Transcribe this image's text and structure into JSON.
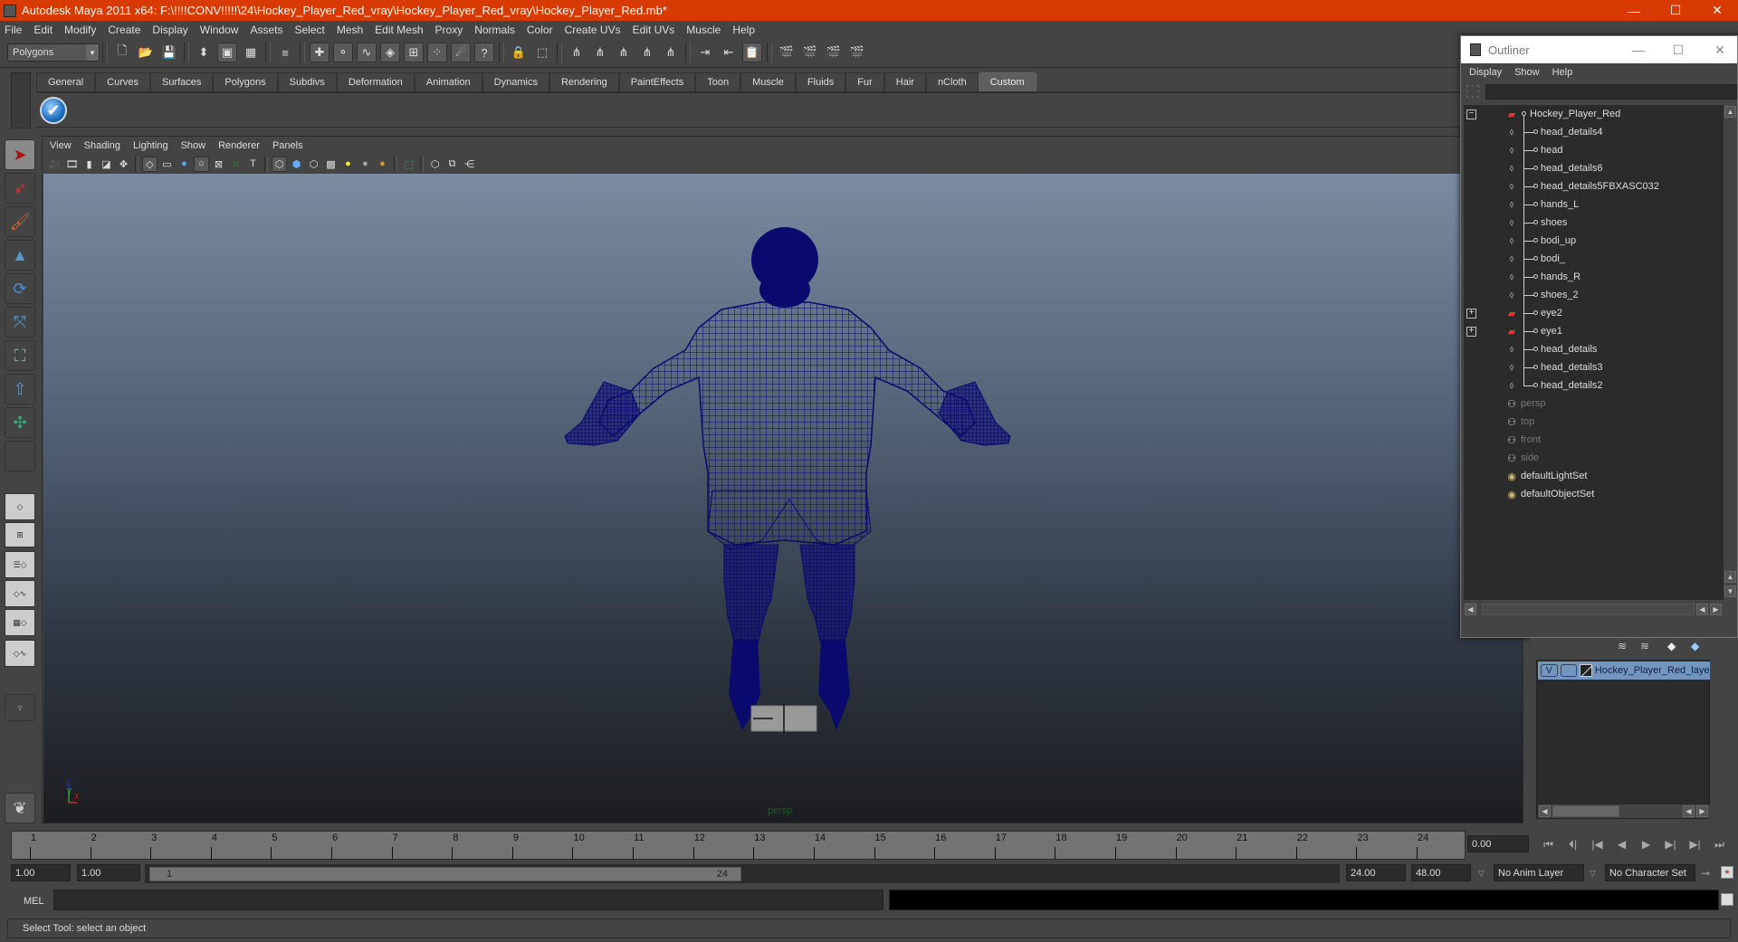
{
  "window": {
    "title": "Autodesk Maya 2011 x64: F:\\!!!!CONV!!!!!\\24\\Hockey_Player_Red_vray\\Hockey_Player_Red_vray\\Hockey_Player_Red.mb*",
    "minimize": "—",
    "maximize": "☐",
    "close": "✕"
  },
  "menubar": [
    "File",
    "Edit",
    "Modify",
    "Create",
    "Display",
    "Window",
    "Assets",
    "Select",
    "Mesh",
    "Edit Mesh",
    "Proxy",
    "Normals",
    "Color",
    "Create UVs",
    "Edit UVs",
    "Muscle",
    "Help"
  ],
  "statusline": {
    "mode": "Polygons",
    "icons": [
      {
        "name": "new-scene-icon",
        "glyph": "🗋"
      },
      {
        "name": "open-scene-icon",
        "glyph": "📂"
      },
      {
        "name": "save-scene-icon",
        "glyph": "💾"
      },
      {
        "name": "select-by-hierarchy-icon",
        "glyph": "⬍"
      },
      {
        "name": "select-by-object-type-icon",
        "glyph": "▣",
        "on": true
      },
      {
        "name": "select-by-component-type-icon",
        "glyph": "▦"
      },
      {
        "name": "mask-menu-icon",
        "glyph": "≡"
      },
      {
        "name": "select-handles-icon",
        "glyph": "✚",
        "on": true
      },
      {
        "name": "select-joints-icon",
        "glyph": "⚬",
        "on": true
      },
      {
        "name": "select-curves-icon",
        "glyph": "∿",
        "on": true
      },
      {
        "name": "select-surfaces-icon",
        "glyph": "◈",
        "on": true
      },
      {
        "name": "select-deformations-icon",
        "glyph": "⊞",
        "on": true
      },
      {
        "name": "select-dynamics-icon",
        "glyph": "⁘",
        "on": true
      },
      {
        "name": "select-rendering-icon",
        "glyph": "☄",
        "on": true
      },
      {
        "name": "select-misc-icon",
        "glyph": "?",
        "on": true
      },
      {
        "name": "lock-selection-icon",
        "glyph": "🔒"
      },
      {
        "name": "highlight-selection-icon",
        "glyph": "⬚"
      },
      {
        "name": "snap-to-grids-icon",
        "glyph": "⋔"
      },
      {
        "name": "snap-to-curves-icon",
        "glyph": "⋔"
      },
      {
        "name": "snap-to-points-icon",
        "glyph": "⋔"
      },
      {
        "name": "snap-to-view-planes-icon",
        "glyph": "⋔"
      },
      {
        "name": "make-live-icon",
        "glyph": "⋔"
      },
      {
        "name": "input-ops-icon",
        "glyph": "⇥"
      },
      {
        "name": "output-ops-icon",
        "glyph": "⇤"
      },
      {
        "name": "construction-history-icon",
        "glyph": "📋",
        "on": true
      },
      {
        "name": "render-view-icon",
        "glyph": "🎬"
      },
      {
        "name": "render-current-frame-icon",
        "glyph": "🎬"
      },
      {
        "name": "ipr-render-icon",
        "glyph": "🎬"
      },
      {
        "name": "render-settings-icon",
        "glyph": "🎬"
      }
    ]
  },
  "shelf": {
    "tabs": [
      "General",
      "Curves",
      "Surfaces",
      "Polygons",
      "Subdivs",
      "Deformation",
      "Animation",
      "Dynamics",
      "Rendering",
      "PaintEffects",
      "Toon",
      "Muscle",
      "Fluids",
      "Fur",
      "Hair",
      "nCloth",
      "Custom"
    ],
    "active_tab": "Custom",
    "items": [
      {
        "name": "custom-check-icon",
        "glyph": "✔"
      }
    ]
  },
  "toolbox": {
    "tools": [
      {
        "name": "select-tool-icon",
        "glyph": "➤",
        "selected": true
      },
      {
        "name": "lasso-tool-icon",
        "glyph": "➶"
      },
      {
        "name": "paint-select-tool-icon",
        "glyph": "🖌"
      },
      {
        "name": "move-tool-icon",
        "glyph": "▲"
      },
      {
        "name": "rotate-tool-icon",
        "glyph": "⟳"
      },
      {
        "name": "scale-tool-icon",
        "glyph": "⤧"
      },
      {
        "name": "universal-manipulator-icon",
        "glyph": "⛶"
      },
      {
        "name": "soft-modification-icon",
        "glyph": "⇧"
      },
      {
        "name": "show-manipulator-icon",
        "glyph": "✣"
      },
      {
        "name": "last-tool-slot-icon",
        "glyph": ""
      }
    ],
    "layouts": [
      {
        "name": "single-perspective-layout-icon",
        "glyph": "◇"
      },
      {
        "name": "four-view-layout-icon",
        "glyph": "⊞"
      },
      {
        "name": "outliner-perspective-layout-icon",
        "glyph": "☰◇"
      },
      {
        "name": "perspective-graph-layout-icon",
        "glyph": "◇∿"
      },
      {
        "name": "hypershade-perspective-layout-icon",
        "glyph": "▦◇"
      },
      {
        "name": "perspective-hypergraph-graph-layout-icon",
        "glyph": "◇∿"
      }
    ],
    "more_layouts": "▿"
  },
  "viewport": {
    "menu": [
      "View",
      "Shading",
      "Lighting",
      "Show",
      "Renderer",
      "Panels"
    ],
    "tools": [
      {
        "name": "select-camera-icon",
        "glyph": "🎥"
      },
      {
        "name": "camera-attributes-icon",
        "glyph": "🎞"
      },
      {
        "name": "bookmarks-icon",
        "glyph": "▮"
      },
      {
        "name": "image-plane-icon",
        "glyph": "◪"
      },
      {
        "name": "two-d-pan-zoom-icon",
        "glyph": "✥"
      },
      {
        "sep": true
      },
      {
        "name": "grid-icon",
        "glyph": "◇",
        "on": true
      },
      {
        "name": "film-gate-icon",
        "glyph": "▭"
      },
      {
        "name": "resolution-gate-icon",
        "glyph": "●"
      },
      {
        "name": "gate-mask-icon",
        "glyph": "○",
        "on": true
      },
      {
        "name": "field-chart-icon",
        "glyph": "⊠"
      },
      {
        "name": "safe-action-icon",
        "glyph": "⁙"
      },
      {
        "name": "safe-title-icon",
        "glyph": "T"
      },
      {
        "sep": true
      },
      {
        "name": "wireframe-icon",
        "glyph": "⬡",
        "on": true
      },
      {
        "name": "smooth-shade-icon",
        "glyph": "⬢"
      },
      {
        "name": "wireframe-on-shaded-icon",
        "glyph": "⬡"
      },
      {
        "name": "textured-icon",
        "glyph": "▩"
      },
      {
        "name": "use-all-lights-icon",
        "glyph": "●"
      },
      {
        "name": "shadows-icon",
        "glyph": "●"
      },
      {
        "name": "high-quality-icon",
        "glyph": "●"
      },
      {
        "sep": true
      },
      {
        "name": "isolate-select-icon",
        "glyph": "⬚"
      },
      {
        "sep": true
      },
      {
        "name": "xray-icon",
        "glyph": "⬡"
      },
      {
        "name": "xray-joints-icon",
        "glyph": "⧉"
      },
      {
        "name": "xray-active-components-icon",
        "glyph": "⋲"
      }
    ],
    "camera_label": "persp",
    "axis": {
      "x": "X",
      "y": "Y",
      "z": "Z"
    }
  },
  "outliner": {
    "title": "Outliner",
    "menu": [
      "Display",
      "Show",
      "Help"
    ],
    "filter_value": "",
    "items": [
      {
        "label": "Hockey_Player_Red",
        "icon": "transform",
        "expand": "−",
        "root": true
      },
      {
        "label": "head_details4",
        "icon": "mesh"
      },
      {
        "label": "head",
        "icon": "mesh"
      },
      {
        "label": "head_details6",
        "icon": "mesh"
      },
      {
        "label": "head_details5FBXASC032",
        "icon": "mesh"
      },
      {
        "label": "hands_L",
        "icon": "mesh"
      },
      {
        "label": "shoes",
        "icon": "mesh"
      },
      {
        "label": "bodi_up",
        "icon": "mesh"
      },
      {
        "label": "bodi_",
        "icon": "mesh"
      },
      {
        "label": "hands_R",
        "icon": "mesh"
      },
      {
        "label": "shoes_2",
        "icon": "mesh"
      },
      {
        "label": "eye2",
        "icon": "transform",
        "expand": "+"
      },
      {
        "label": "eye1",
        "icon": "transform",
        "expand": "+"
      },
      {
        "label": "head_details",
        "icon": "mesh"
      },
      {
        "label": "head_details3",
        "icon": "mesh"
      },
      {
        "label": "head_details2",
        "icon": "mesh"
      },
      {
        "label": "persp",
        "icon": "camera",
        "dim": true
      },
      {
        "label": "top",
        "icon": "camera",
        "dim": true
      },
      {
        "label": "front",
        "icon": "camera",
        "dim": true
      },
      {
        "label": "side",
        "icon": "camera",
        "dim": true
      },
      {
        "label": "defaultLightSet",
        "icon": "set"
      },
      {
        "label": "defaultObjectSet",
        "icon": "set"
      }
    ]
  },
  "layer_editor": {
    "layers": [
      {
        "visible": "V",
        "template": "",
        "name": "Hockey_Player_Red_layer"
      }
    ]
  },
  "timeline": {
    "start": 1,
    "end": 24,
    "ticks": [
      "1",
      "2",
      "3",
      "4",
      "5",
      "6",
      "7",
      "8",
      "9",
      "10",
      "11",
      "12",
      "13",
      "14",
      "15",
      "16",
      "17",
      "18",
      "19",
      "20",
      "21",
      "22",
      "23",
      "24"
    ],
    "current_frame": "0.00"
  },
  "playback": [
    {
      "name": "go-to-start-button",
      "glyph": "⏮"
    },
    {
      "name": "step-back-frame-button",
      "glyph": "⏴|"
    },
    {
      "name": "step-back-key-button",
      "glyph": "|◀"
    },
    {
      "name": "play-backwards-button",
      "glyph": "◀"
    },
    {
      "name": "play-forwards-button",
      "glyph": "▶"
    },
    {
      "name": "step-forward-key-button",
      "glyph": "▶|"
    },
    {
      "name": "step-forward-frame-button",
      "glyph": "▶|"
    },
    {
      "name": "go-to-end-button",
      "glyph": "⏭"
    }
  ],
  "range": {
    "anim_start": "1.00",
    "playback_start": "1.00",
    "slider_start": "1",
    "slider_end": "24",
    "playback_end": "24.00",
    "anim_end": "48.00",
    "anim_layer": "No Anim Layer",
    "character_set": "No Character Set"
  },
  "command_line": {
    "label": "MEL",
    "value": "",
    "output": ""
  },
  "help_line": "Select Tool: select an object",
  "colors": {
    "title_bar": "#d83b01",
    "wireframe": "#0a0a6e",
    "layer_selected": "#7396c0"
  }
}
